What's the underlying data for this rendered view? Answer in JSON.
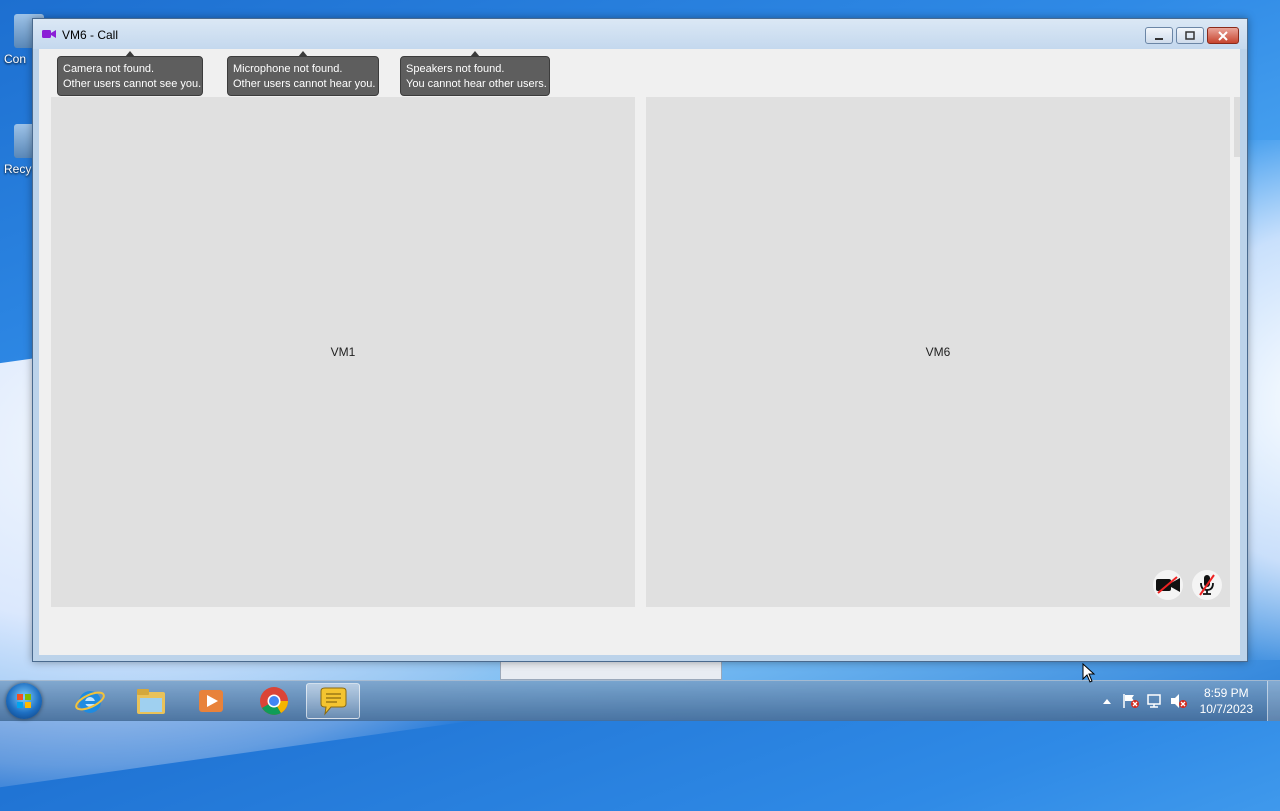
{
  "desktop": {
    "icons": [
      {
        "label": "Con",
        "icon": "computer-icon"
      },
      {
        "label": "Recy",
        "icon": "recycle-bin-icon"
      }
    ]
  },
  "window": {
    "title": "VM6 - Call",
    "title_icon": "video-camera-icon",
    "buttons": {
      "minimize": "minimize-icon",
      "maximize": "maximize-icon",
      "close": "close-icon"
    }
  },
  "tooltips": [
    {
      "line1": "Camera not found.",
      "line2": "Other users cannot see you."
    },
    {
      "line1": "Microphone not found.",
      "line2": "Other users cannot hear you."
    },
    {
      "line1": "Speakers not found.",
      "line2": "You cannot hear other users."
    }
  ],
  "tiles": [
    {
      "label": "VM1"
    },
    {
      "label": "VM6"
    }
  ],
  "controls": {
    "camera_off": "camera-off-icon",
    "mic_off": "microphone-off-icon"
  },
  "taskbar": {
    "items": [
      "internet-explorer-icon",
      "file-explorer-icon",
      "media-player-icon",
      "chrome-icon",
      "chat-app-icon"
    ],
    "active_item": "chat-app-icon",
    "tray_icons": [
      "show-hidden-icons-arrow",
      "action-center-flag-icon",
      "network-icon",
      "volume-muted-icon"
    ],
    "clock": {
      "time": "8:59 PM",
      "date": "10/7/2023"
    }
  },
  "colors": {
    "tooltip_bg": "#5e5e5e",
    "tile_bg": "#e0e0e0",
    "close_red": "#c7442e",
    "title_icon_purple": "#8b1fd6"
  }
}
